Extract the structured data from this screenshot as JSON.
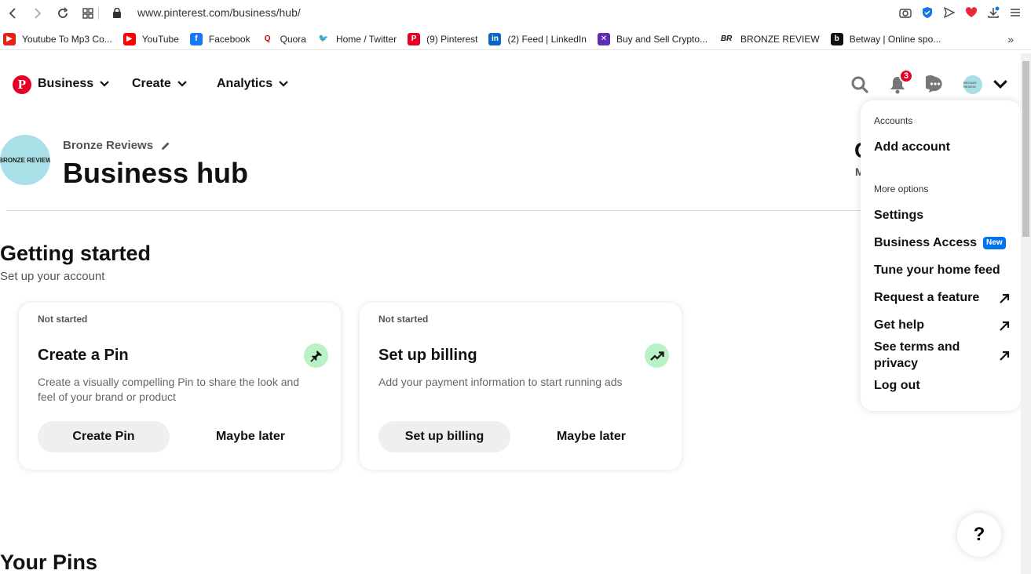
{
  "browser": {
    "url": "www.pinterest.com/business/hub/",
    "bookmarks": [
      {
        "label": "Youtube To Mp3 Co...",
        "color": "#e62117",
        "glyph": "▶"
      },
      {
        "label": "YouTube",
        "color": "#ff0000",
        "glyph": "▶"
      },
      {
        "label": "Facebook",
        "color": "#1877f2",
        "glyph": "f"
      },
      {
        "label": "Quora",
        "color": "#ffffff",
        "glyph": "Q"
      },
      {
        "label": "Home / Twitter",
        "color": "#ffffff",
        "glyph": "🐦"
      },
      {
        "label": "(9) Pinterest",
        "color": "#e60023",
        "glyph": "P"
      },
      {
        "label": "(2) Feed | LinkedIn",
        "color": "#0a66c2",
        "glyph": "in"
      },
      {
        "label": "Buy and Sell Crypto...",
        "color": "#5f2db5",
        "glyph": "✕"
      },
      {
        "label": "BRONZE REVIEW",
        "color": "#ffffff",
        "glyph": "BR"
      },
      {
        "label": "Betway | Online spo...",
        "color": "#111111",
        "glyph": "b"
      }
    ]
  },
  "header": {
    "menus": [
      "Business",
      "Create",
      "Analytics"
    ],
    "notification_count": "3",
    "avatar_text": "BRONZE REVIEW"
  },
  "profile": {
    "avatar_text": "BRONZE REVIEW",
    "account_name": "Bronze Reviews",
    "page_title": "Business hub",
    "clipped_title": "C",
    "clipped_sub": "M"
  },
  "getting_started": {
    "title": "Getting started",
    "subtitle": "Set up your account",
    "cards": [
      {
        "status": "Not started",
        "title": "Create a Pin",
        "description": "Create a visually compelling Pin to share the look and feel of your brand or product",
        "primary": "Create Pin",
        "secondary": "Maybe later",
        "icon": "pin-icon"
      },
      {
        "status": "Not started",
        "title": "Set up billing",
        "description": "Add your payment information to start running ads",
        "primary": "Set up billing",
        "secondary": "Maybe later",
        "icon": "trending-up-icon"
      }
    ]
  },
  "your_pins": {
    "title": "Your Pins"
  },
  "dropdown": {
    "accounts_label": "Accounts",
    "add_account": "Add account",
    "more_options_label": "More options",
    "settings": "Settings",
    "business_access": "Business Access",
    "new_badge": "New",
    "tune_feed": "Tune your home feed",
    "request_feature": "Request a feature",
    "get_help": "Get help",
    "terms": "See terms and privacy",
    "log_out": "Log out"
  },
  "help": {
    "label": "?"
  }
}
